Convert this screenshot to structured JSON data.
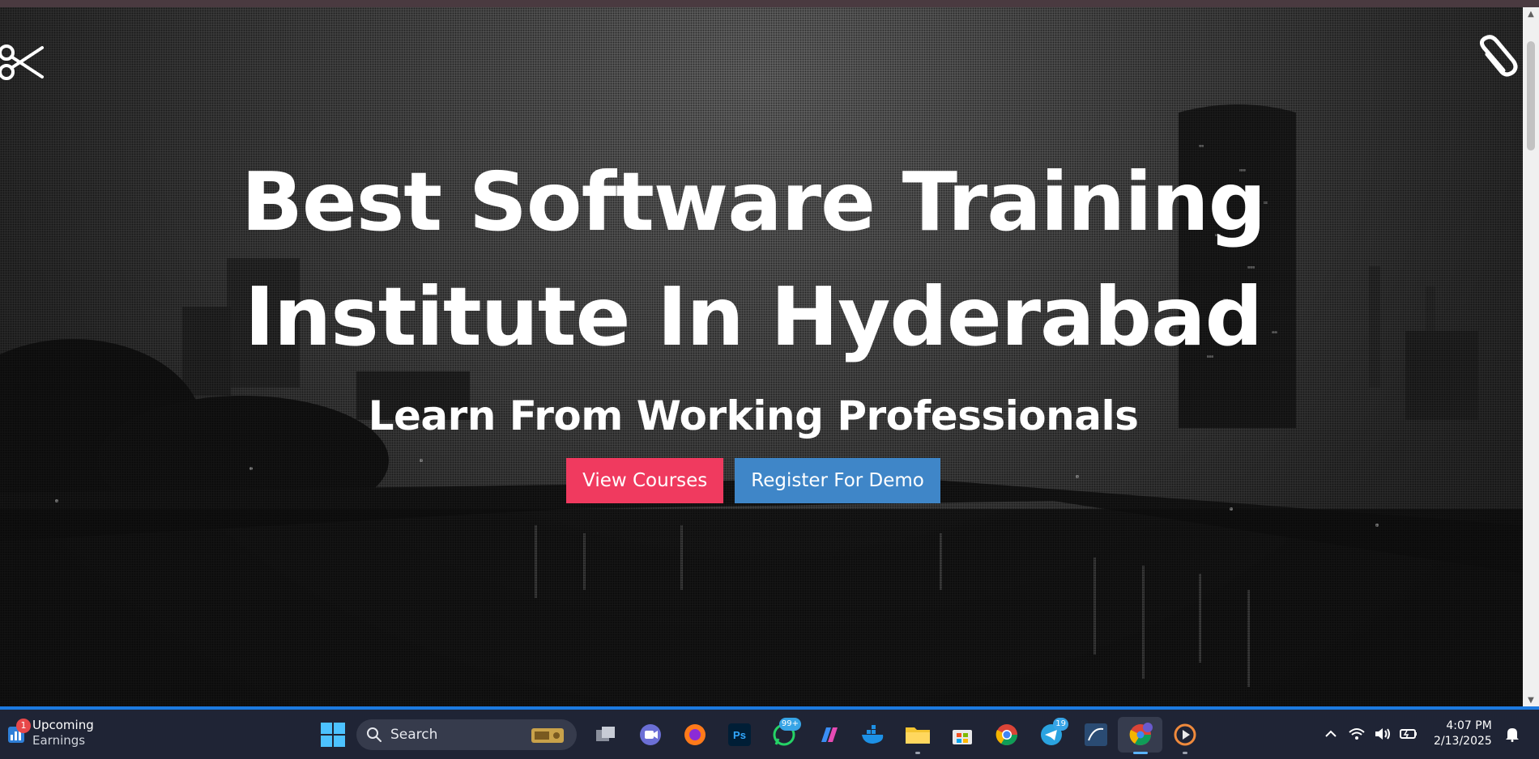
{
  "hero": {
    "title_line1": "Best Software Training",
    "title_line2": "Institute In Hyderabad",
    "subtitle": "Learn From Working Professionals",
    "buttons": {
      "view_courses": "View Courses",
      "register_demo": "Register For Demo"
    },
    "icons": [
      "scissors-icon",
      "paperclip-icon"
    ]
  },
  "colors": {
    "view_courses_bg": "#f03a5f",
    "register_demo_bg": "#3f86c8",
    "taskbar_bg": "#1f2435",
    "taskbar_accent": "#1c7ae0"
  },
  "taskbar": {
    "widget": {
      "title": "Upcoming",
      "subtitle": "Earnings",
      "badge": "1"
    },
    "search_label": "Search",
    "apps": [
      {
        "name": "task-view",
        "badge": ""
      },
      {
        "name": "teams-meet",
        "badge": ""
      },
      {
        "name": "firefox",
        "badge": ""
      },
      {
        "name": "photoshop",
        "label": "Ps",
        "badge": ""
      },
      {
        "name": "whatsapp",
        "badge": "99+"
      },
      {
        "name": "copilot",
        "badge": ""
      },
      {
        "name": "docker",
        "badge": ""
      },
      {
        "name": "file-explorer",
        "badge": ""
      },
      {
        "name": "microsoft-store",
        "badge": ""
      },
      {
        "name": "chrome",
        "badge": ""
      },
      {
        "name": "telegram",
        "badge": "19"
      },
      {
        "name": "mysql-workbench",
        "badge": ""
      },
      {
        "name": "chrome-profile",
        "badge": ""
      },
      {
        "name": "media-player",
        "badge": ""
      }
    ],
    "clock": {
      "time": "4:07 PM",
      "date": "2/13/2025"
    }
  }
}
